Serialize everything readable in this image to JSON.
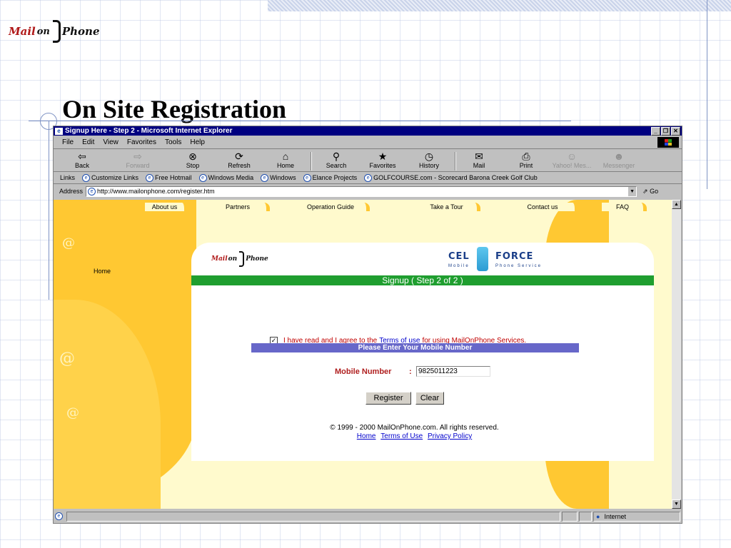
{
  "slide": {
    "title": "On Site Registration",
    "logo": {
      "mail": "Mail",
      "on": "on",
      "phone": "Phone"
    }
  },
  "window": {
    "title": "Signup Here - Step 2 - Microsoft Internet Explorer",
    "buttons": [
      "_",
      "❐",
      "✕"
    ]
  },
  "menu": [
    "File",
    "Edit",
    "View",
    "Favorites",
    "Tools",
    "Help"
  ],
  "toolbar": [
    {
      "label": "Back",
      "glyph": "⇦"
    },
    {
      "label": "Forward",
      "glyph": "⇨"
    },
    {
      "label": "Stop",
      "glyph": "⊗"
    },
    {
      "label": "Refresh",
      "glyph": "⟳"
    },
    {
      "label": "Home",
      "glyph": "⌂"
    },
    {
      "label": "Search",
      "glyph": "⚲"
    },
    {
      "label": "Favorites",
      "glyph": "★"
    },
    {
      "label": "History",
      "glyph": "◷"
    },
    {
      "label": "Mail",
      "glyph": "✉"
    },
    {
      "label": "Print",
      "glyph": "⎙"
    },
    {
      "label": "Yahoo! Mes...",
      "glyph": "☺"
    },
    {
      "label": "Messenger",
      "glyph": "☻"
    }
  ],
  "links": {
    "label": "Links",
    "items": [
      "Customize Links",
      "Free Hotmail",
      "Windows Media",
      "Windows",
      "Elance Projects",
      "GOLFCOURSE.com - Scorecard Barona Creek Golf Club"
    ]
  },
  "address": {
    "label": "Address",
    "url": "http://www.mailonphone.com/register.htm",
    "go": "Go"
  },
  "page": {
    "nav": [
      "About us",
      "Partners",
      "Operation Guide",
      "Take a Tour",
      "Contact us",
      "FAQ"
    ],
    "home_link": "Home",
    "at_glyph": "@",
    "logo": {
      "mail": "Mail",
      "on": "on",
      "phone": "Phone"
    },
    "celforce": {
      "cel": "CEL",
      "force": "FORCE",
      "mobile": "Mobile",
      "service": "Phone Service"
    },
    "signup_header": "Signup ( Step 2 of 2 )",
    "agree": {
      "checked": true,
      "check_glyph": "✓",
      "before": "I have read and I agree to the",
      "link": "Terms of use",
      "after": "for using MailOnPhone Services."
    },
    "enter_header": "Please Enter Your Mobile Number",
    "mobile_label": "Mobile Number",
    "mobile_colon": ":",
    "mobile_value": "9825011223",
    "register_label": "Register",
    "clear_label": "Clear",
    "copyright": "© 1999 - 2000 MailOnPhone.com. All rights reserved.",
    "footer_links": [
      "Home",
      "Terms of Use",
      "Privacy Policy"
    ]
  },
  "status": {
    "zone": "Internet"
  },
  "colors": {
    "titlebar": "#000080",
    "page_bg": "#fffacd",
    "yellow": "#ffc832",
    "green": "#1f9e2f",
    "purple": "#6767c9"
  }
}
